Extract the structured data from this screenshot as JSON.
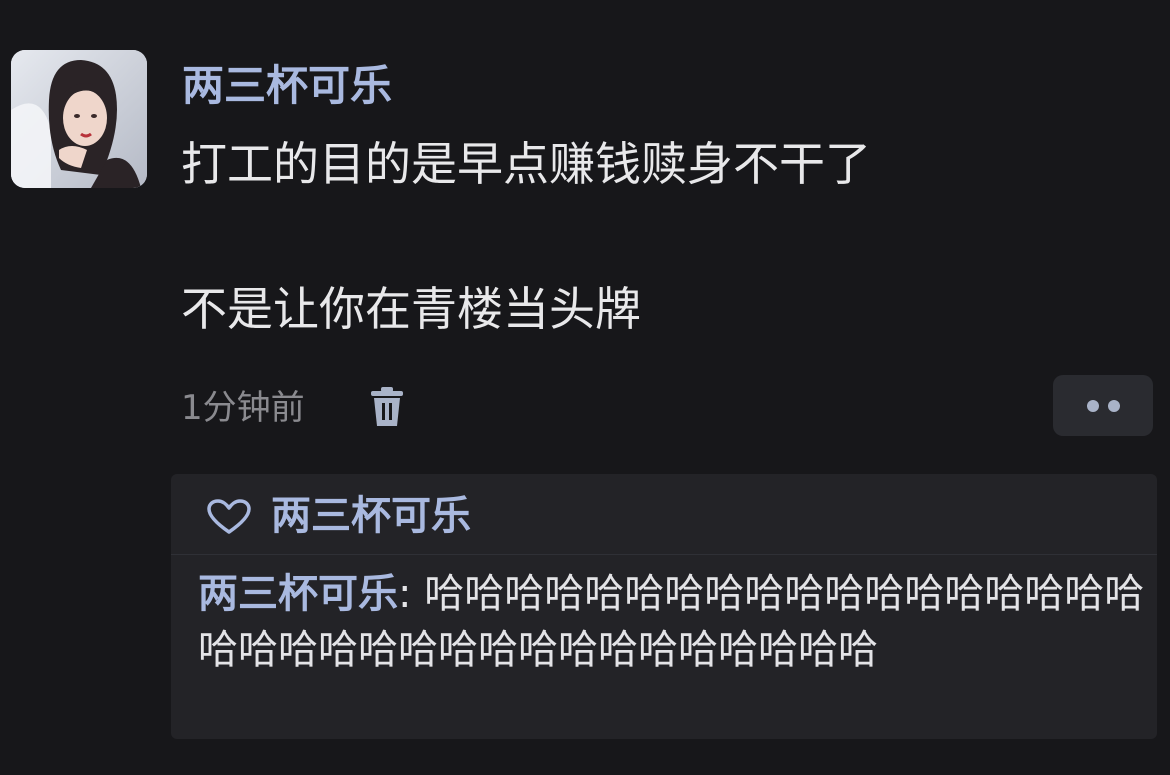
{
  "comment": {
    "username": "两三杯可乐",
    "content_line1": "打工的目的是早点赚钱赎身不干了",
    "content_line2": "不是让你在青楼当头牌",
    "timestamp": "1分钟前",
    "icons": {
      "delete": "trash-icon",
      "more": "more-dots-icon",
      "avatar": "avatar"
    }
  },
  "reply_section": {
    "liked_by": "两三杯可乐",
    "like_icon": "heart-icon",
    "reply": {
      "author": "两三杯可乐",
      "separator": ": ",
      "text": "哈哈哈哈哈哈哈哈哈哈哈哈哈哈哈哈哈哈哈哈哈哈哈哈哈哈哈哈哈哈哈哈哈哈哈"
    }
  },
  "colors": {
    "background": "#17171a",
    "username": "#a9b9e0",
    "text": "#e8e8ea",
    "muted": "#8a8a8f",
    "reply_bg": "#232327"
  }
}
